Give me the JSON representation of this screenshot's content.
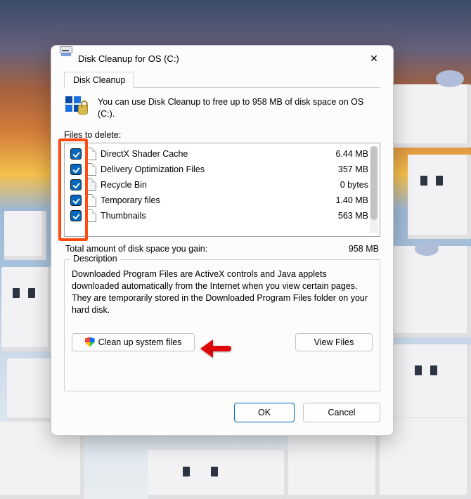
{
  "window": {
    "title": "Disk Cleanup for OS (C:)"
  },
  "tab": {
    "label": "Disk Cleanup"
  },
  "intro": "You can use Disk Cleanup to free up to 958 MB of disk space on OS (C:).",
  "files_label": "Files to delete:",
  "items": [
    {
      "name": "DirectX Shader Cache",
      "size": "6.44 MB"
    },
    {
      "name": "Delivery Optimization Files",
      "size": "357 MB"
    },
    {
      "name": "Recycle Bin",
      "size": "0 bytes"
    },
    {
      "name": "Temporary files",
      "size": "1.40 MB"
    },
    {
      "name": "Thumbnails",
      "size": "563 MB"
    }
  ],
  "total": {
    "label": "Total amount of disk space you gain:",
    "value": "958 MB"
  },
  "description": {
    "legend": "Description",
    "text": "Downloaded Program Files are ActiveX controls and Java applets downloaded automatically from the Internet when you view certain pages. They are temporarily stored in the Downloaded Program Files folder on your hard disk."
  },
  "buttons": {
    "cleanup_system": "Clean up system files",
    "view_files": "View Files",
    "ok": "OK",
    "cancel": "Cancel"
  }
}
